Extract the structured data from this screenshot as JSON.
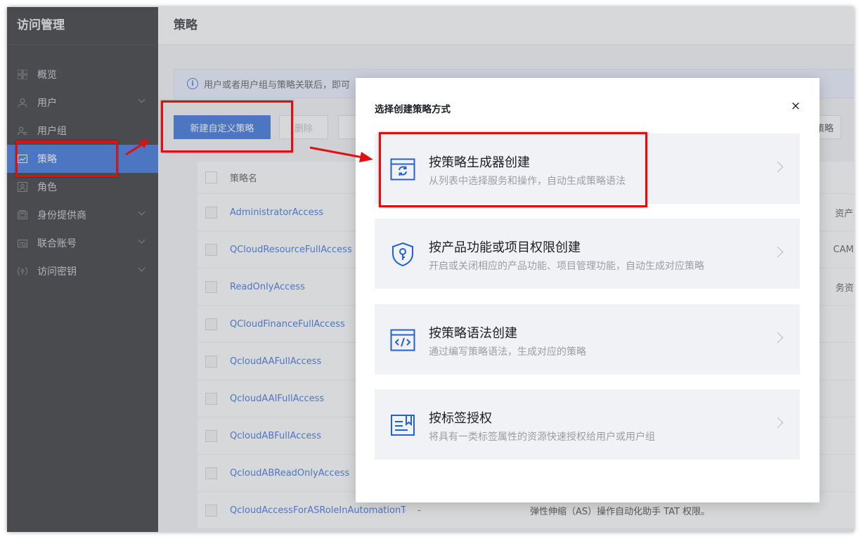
{
  "sidebar": {
    "title": "访问管理",
    "items": [
      {
        "label": "概览",
        "icon": "grid-icon",
        "has_chevron": false
      },
      {
        "label": "用户",
        "icon": "user-icon",
        "has_chevron": true
      },
      {
        "label": "用户组",
        "icon": "user-group-icon",
        "has_chevron": false
      },
      {
        "label": "策略",
        "icon": "policy-icon",
        "has_chevron": false,
        "active": true
      },
      {
        "label": "角色",
        "icon": "role-icon",
        "has_chevron": false
      },
      {
        "label": "身份提供商",
        "icon": "identity-provider-icon",
        "has_chevron": true
      },
      {
        "label": "联合账号",
        "icon": "federated-account-icon",
        "has_chevron": true
      },
      {
        "label": "访问密钥",
        "icon": "access-key-icon",
        "has_chevron": true
      }
    ]
  },
  "main": {
    "title": "策略",
    "info_text": "用户或者用户组与策略关联后，即可",
    "toolbar": {
      "create_label": "新建自定义策略",
      "delete_label": "删除",
      "right_label": "策略"
    },
    "table": {
      "header": "策略名",
      "rows": [
        {
          "name": "AdministratorAccess",
          "dash": "",
          "desc": "",
          "tail": "资产。"
        },
        {
          "name": "QCloudResourceFullAccess",
          "dash": "",
          "desc": "",
          "tail": "CAM..."
        },
        {
          "name": "ReadOnlyAccess",
          "dash": "",
          "desc": "",
          "tail": "务资..."
        },
        {
          "name": "QCloudFinanceFullAccess",
          "dash": "",
          "desc": "",
          "tail": ""
        },
        {
          "name": "QcloudAAFullAccess",
          "dash": "",
          "desc": "",
          "tail": ""
        },
        {
          "name": "QcloudAAIFullAccess",
          "dash": "",
          "desc": "",
          "tail": ""
        },
        {
          "name": "QcloudABFullAccess",
          "dash": "",
          "desc": "",
          "tail": ""
        },
        {
          "name": "QcloudABReadOnlyAccess",
          "dash": "",
          "desc": "",
          "tail": ""
        },
        {
          "name": "QcloudAccessForASRoleInAutomationTools",
          "dash": "-",
          "desc": "弹性伸缩（AS）操作自动化助手 TAT 权限。",
          "tail": ""
        }
      ]
    }
  },
  "modal": {
    "title": "选择创建策略方式",
    "close": "×",
    "options": [
      {
        "title": "按策略生成器创建",
        "desc": "从列表中选择服务和操作，自动生成策略语法",
        "icon": "policy-generator-icon"
      },
      {
        "title": "按产品功能或项目权限创建",
        "desc": "开启或关闭相应的产品功能、项目管理功能，自动生成对应策略",
        "icon": "shield-key-icon"
      },
      {
        "title": "按策略语法创建",
        "desc": "通过编写策略语法，生成对应的策略",
        "icon": "code-window-icon"
      },
      {
        "title": "按标签授权",
        "desc": "将具有一类标签属性的资源快速授权给用户或用户组",
        "icon": "tag-book-icon"
      }
    ]
  },
  "colors": {
    "primary": "#2162d9",
    "sidebar_bg": "#1c1c1f",
    "annotation_red": "#e30f0f"
  }
}
